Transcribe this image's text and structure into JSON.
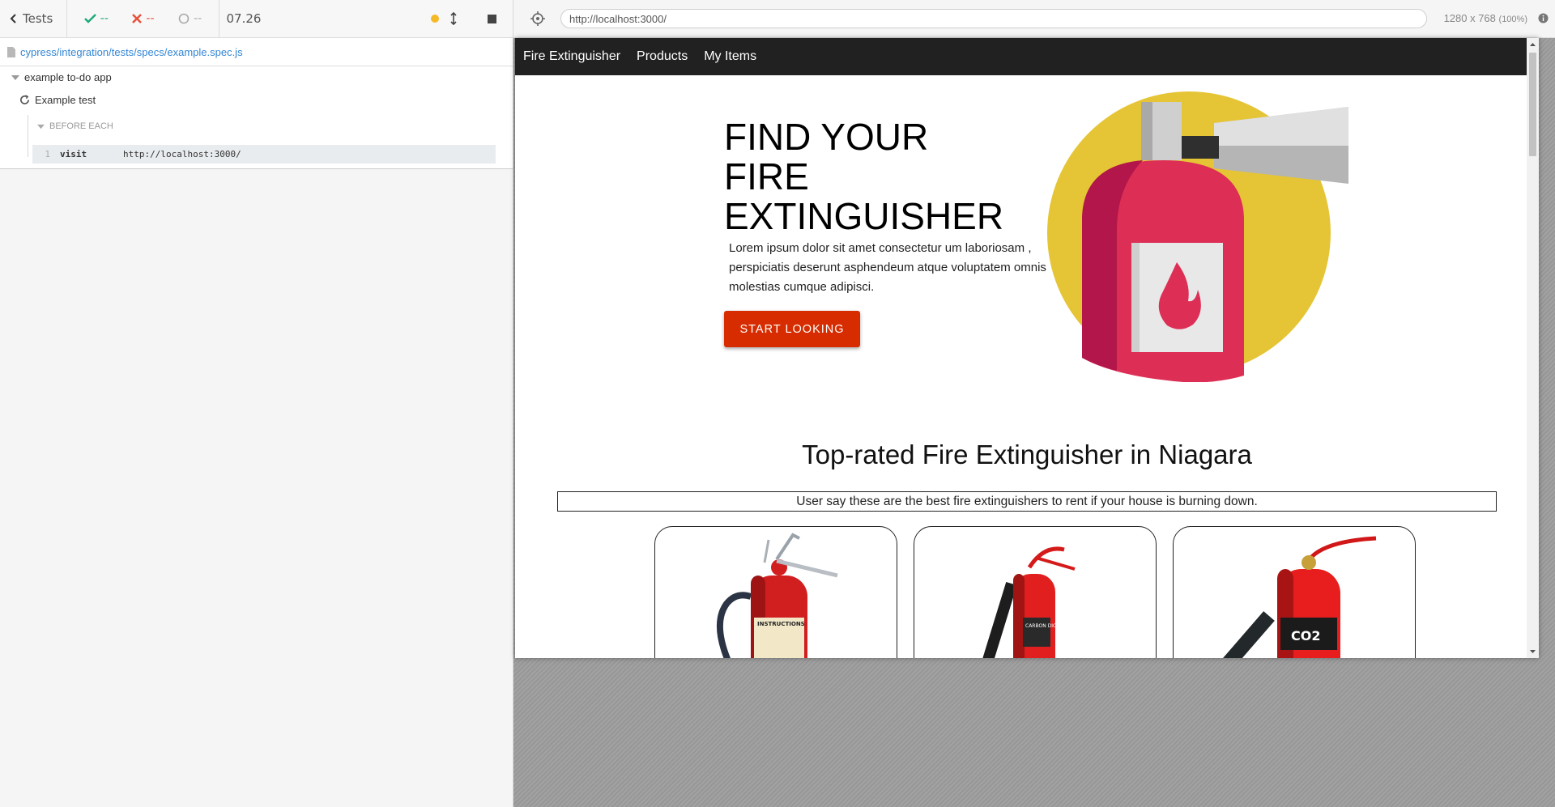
{
  "reporter": {
    "tests_label": "Tests",
    "passed": "--",
    "failed": "--",
    "pending": "--",
    "duration": "07.26",
    "spec_path": "cypress/integration/tests/specs/example.spec.js",
    "suite_title": "example to-do app",
    "test_title": "Example test",
    "hook_title": "BEFORE EACH",
    "command": {
      "number": "1",
      "name": "visit",
      "message": "http://localhost:3000/"
    }
  },
  "url_bar": {
    "url": "http://localhost:3000/",
    "viewport": "1280 x 768",
    "zoom": "(100%)"
  },
  "app": {
    "nav": [
      "Fire Extinguisher",
      "Products",
      "My Items"
    ],
    "hero": {
      "title_lines": [
        "FIND YOUR",
        "FIRE",
        "EXTINGUISHER"
      ],
      "text": "Lorem ipsum dolor sit amet consectetur um laboriosam , perspiciatis deserunt asphendeum atque voluptatem omnis molestias cumque adipisci.",
      "button": "START LOOKING"
    },
    "section": {
      "title": "Top-rated Fire Extinguisher in Niagara",
      "subtitle": "User say these are the best fire extinguishers to rent if your house is burning down."
    },
    "product_labels": [
      "INSTRUCTIONS",
      "CARBON DIOXIDE",
      "CO2"
    ]
  },
  "colors": {
    "accent_button": "#d62c00",
    "nav_bg": "#212121",
    "hero_circle": "#e5c535",
    "extinguisher_body": "#dd2e56",
    "link_blue": "#3386d4",
    "pass_green": "#1faa78",
    "fail_red": "#e94f3a",
    "running_yellow": "#f5b925"
  }
}
